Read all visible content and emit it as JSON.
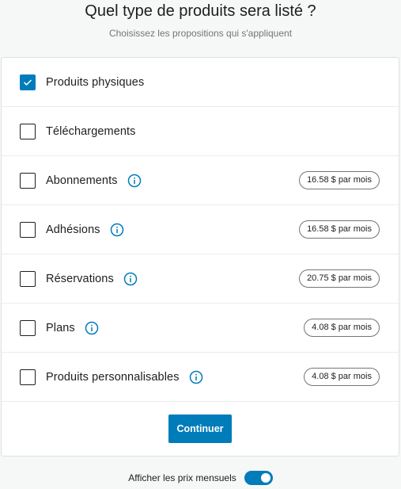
{
  "header": {
    "title": "Quel type de produits sera listé ?",
    "subtitle": "Choisissez les propositions qui s'appliquent"
  },
  "options": [
    {
      "label": "Produits physiques",
      "checked": true,
      "info": false,
      "price": ""
    },
    {
      "label": "Téléchargements",
      "checked": false,
      "info": false,
      "price": ""
    },
    {
      "label": "Abonnements",
      "checked": false,
      "info": true,
      "price": "16.58 $ par mois"
    },
    {
      "label": "Adhésions",
      "checked": false,
      "info": true,
      "price": "16.58 $ par mois"
    },
    {
      "label": "Réservations",
      "checked": false,
      "info": true,
      "price": "20.75 $ par mois"
    },
    {
      "label": "Plans",
      "checked": false,
      "info": true,
      "price": "4.08 $ par mois"
    },
    {
      "label": "Produits personnalisables",
      "checked": false,
      "info": true,
      "price": "4.08 $ par mois"
    }
  ],
  "actions": {
    "continue_label": "Continuer"
  },
  "footer": {
    "toggle_label": "Afficher les prix mensuels",
    "toggle_on": true
  },
  "colors": {
    "accent": "#007cba",
    "background": "#f6f7f7"
  },
  "icons": {
    "checkbox": "check-icon",
    "info": "info-icon"
  }
}
